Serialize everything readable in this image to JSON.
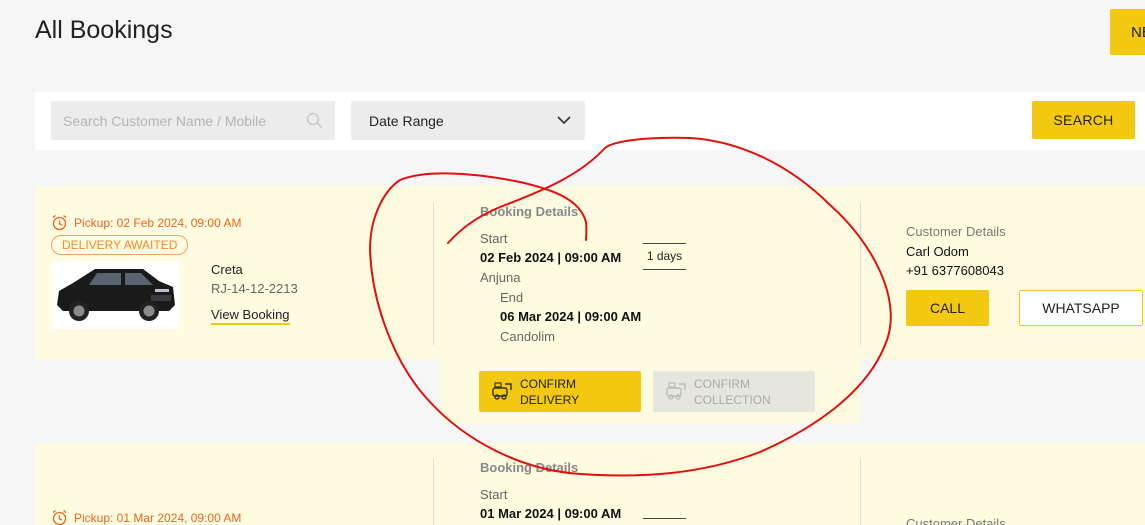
{
  "header": {
    "title": "All Bookings",
    "new_button_label": "NE"
  },
  "filters": {
    "search_placeholder": "Search Customer Name / Mobile",
    "date_range_label": "Date Range",
    "search_button_label": "SEARCH"
  },
  "bookings": [
    {
      "pickup_text": "Pickup: 02 Feb 2024, 09:00 AM",
      "status_badge": "DELIVERY AWAITED",
      "car_model": "Creta",
      "plate": "RJ-14-12-2213",
      "view_link": "View Booking",
      "details_heading": "Booking Details",
      "start_label": "Start",
      "start_datetime": "02 Feb 2024 | 09:00 AM",
      "start_location": "Anjuna",
      "duration": "1 days",
      "end_label": "End",
      "end_datetime": "06 Mar 2024 | 09:00 AM",
      "end_location": "Candolim",
      "customer_heading": "Customer Details",
      "customer_name": "Carl Odom",
      "customer_phone": "+91 6377608043",
      "call_label": "CALL",
      "whatsapp_label": "WHATSAPP",
      "confirm_delivery_line1": "CONFIRM",
      "confirm_delivery_line2": "DELIVERY",
      "confirm_collection_line1": "CONFIRM",
      "confirm_collection_line2": "COLLECTION"
    },
    {
      "pickup_text": "Pickup: 01 Mar 2024, 09:00 AM",
      "details_heading": "Booking Details",
      "start_label": "Start",
      "start_datetime": "01 Mar 2024 | 09:00 AM",
      "customer_heading": "Customer Details"
    }
  ],
  "colors": {
    "accent": "#f2c811",
    "card_bg": "#fffbe0",
    "pickup_orange": "#e06a1f",
    "annotation_red": "#e01010"
  },
  "icons": {
    "search": "search-icon",
    "chevron": "chevron-down-icon",
    "alarm": "alarm-clock-icon",
    "delivery": "car-delivery-icon",
    "collection": "car-collection-icon"
  }
}
